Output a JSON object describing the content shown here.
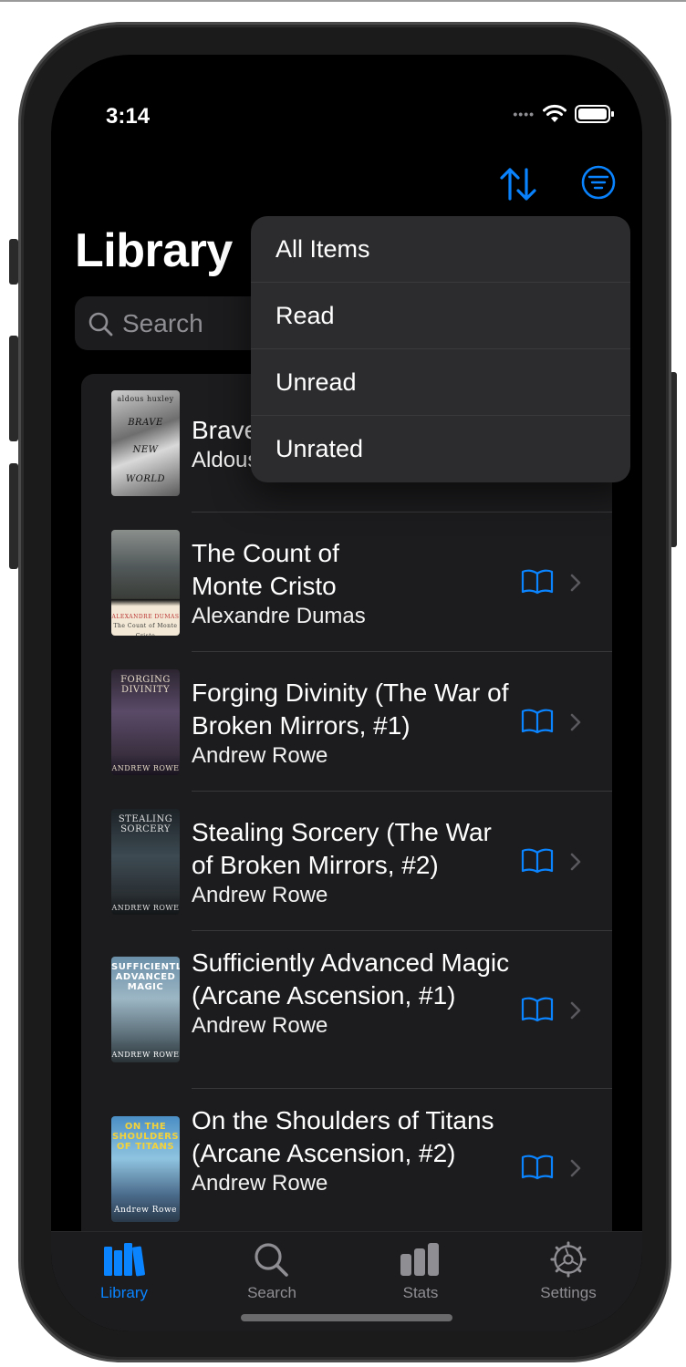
{
  "status_bar": {
    "time": "3:14"
  },
  "nav": {
    "sort_icon": "sort-arrows-icon",
    "filter_icon": "filter-circle-icon",
    "accent": "#0a84ff"
  },
  "page": {
    "title": "Library"
  },
  "search": {
    "placeholder": "Search"
  },
  "books": [
    {
      "title": "Brave New World",
      "author": "Aldous Huxley",
      "cover_text_top": "aldous huxley",
      "cover_text_mid": "BRAVE",
      "cover_text_mid2": "NEW",
      "cover_text_bottom": "WORLD"
    },
    {
      "title": "The Count of Monte Cristo",
      "author": "Alexandre Dumas",
      "cover_text_top": "",
      "cover_text_mid": "ALEXANDRE DUMAS",
      "cover_text_mid2": "The Count of Monte Cristo",
      "cover_text_bottom": ""
    },
    {
      "title": "Forging Divinity (The War of Broken Mirrors, #1)",
      "author": "Andrew Rowe",
      "cover_text_top": "FORGING DIVINITY",
      "cover_text_bottom": "ANDREW ROWE"
    },
    {
      "title": "Stealing Sorcery (The War of Broken Mirrors, #2)",
      "author": "Andrew Rowe",
      "cover_text_top": "STEALING SORCERY",
      "cover_text_bottom": "ANDREW ROWE"
    },
    {
      "title": "Sufficiently Advanced Magic (Arcane Ascension, #1)",
      "author": "Andrew Rowe",
      "cover_text_top": "SUFFICIENTLY ADVANCED MAGIC",
      "cover_text_bottom": "ANDREW ROWE"
    },
    {
      "title": "On the Shoulders of Titans (Arcane Ascension, #2)",
      "author": "Andrew Rowe",
      "cover_text_top": "ON THE SHOULDERS OF TITANS",
      "cover_text_bottom": "Andrew Rowe"
    }
  ],
  "filter_menu": {
    "items": [
      "All Items",
      "Read",
      "Unread",
      "Unrated"
    ]
  },
  "tabbar": {
    "tabs": [
      {
        "label": "Library",
        "icon": "library-books-icon",
        "active": true
      },
      {
        "label": "Search",
        "icon": "magnifier-icon",
        "active": false
      },
      {
        "label": "Stats",
        "icon": "bar-chart-icon",
        "active": false
      },
      {
        "label": "Settings",
        "icon": "gear-icon",
        "active": false
      }
    ],
    "active_color": "#0a84ff",
    "inactive_color": "#8e8e93"
  }
}
